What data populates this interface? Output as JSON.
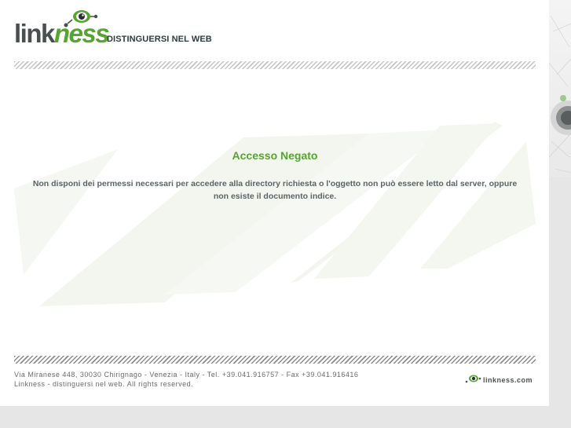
{
  "header": {
    "logo": {
      "text_main": "link",
      "text_accent": "ness",
      "icon": "eye-icon"
    },
    "tagline": "DISTINGUERSI NEL WEB"
  },
  "main": {
    "title": "Accesso Negato",
    "message_line1": "Non disponi dei permessi necessari per accedere alla directory richiesta o l'oggetto non può essere letto dal server, oppure",
    "message_line2": "non esiste il documento indice."
  },
  "footer": {
    "address_line1": "Via Miranese 448, 30030 Chirignago - Venezia - Italy - Tel. +39.041.916757 - Fax +39.041.916416",
    "address_line2": "Linkness - distinguersi nel web. All rights reserved.",
    "logo_text": "linkness.com",
    "logo_icon": "eye-icon"
  },
  "colors": {
    "accent": "#55a52e",
    "logo_gray": "#4a4f4f",
    "text_gray": "#5b6466",
    "page_bg": "#ffffff",
    "outer_bg": "#e6e6e6"
  }
}
